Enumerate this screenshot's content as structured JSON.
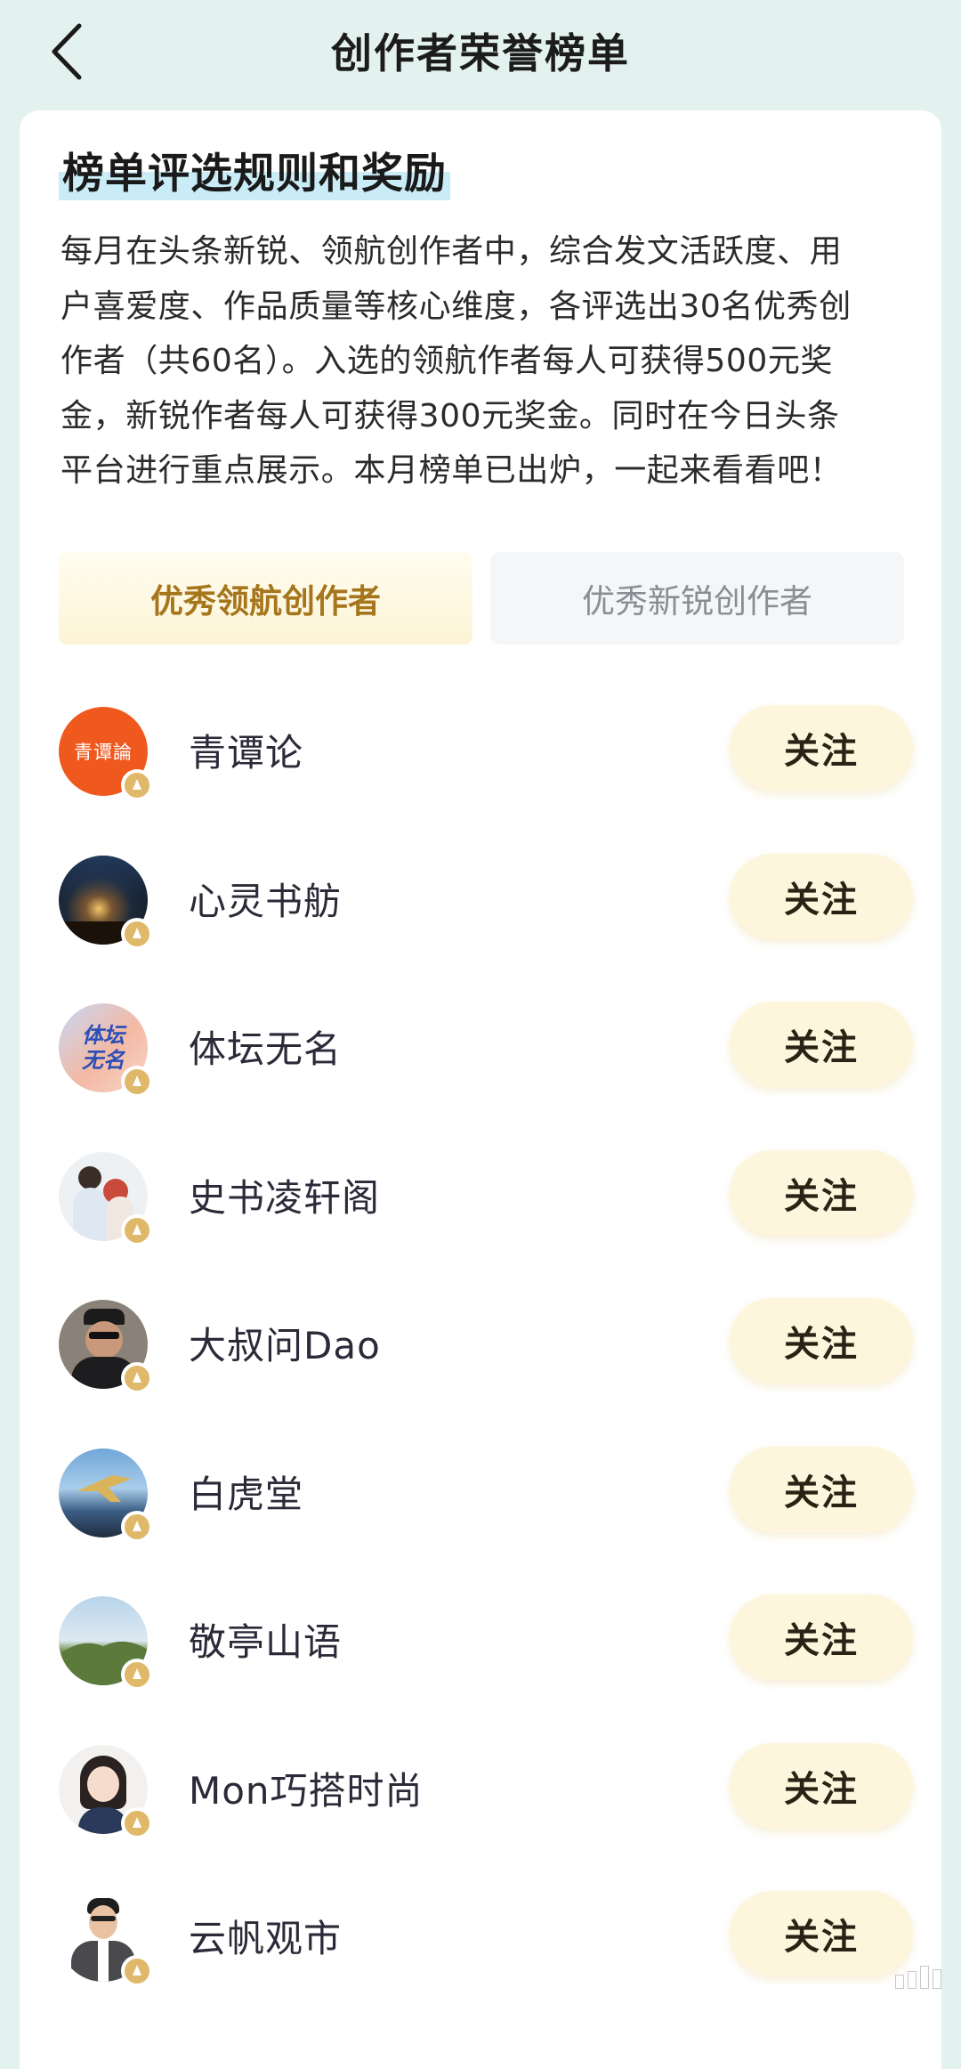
{
  "header": {
    "title": "创作者荣誉榜单",
    "back_icon": "back-arrow-icon"
  },
  "rules": {
    "heading": "榜单评选规则和奖励",
    "lines": [
      "每月在头条新锐、领航创作者中，综合发文活跃度、用",
      "户喜爱度、作品质量等核心维度，各评选出30名优秀创",
      "作者（共60名）。入选的领航作者每人可获得500元奖",
      "金，新锐作者每人可获得300元奖金。同时在今日头条",
      "平台进行重点展示。本月榜单已出炉，一起来看看吧！"
    ]
  },
  "tabs": [
    {
      "label": "优秀领航创作者",
      "active": true
    },
    {
      "label": "优秀新锐创作者",
      "active": false
    }
  ],
  "creators": [
    {
      "name": "青谭论",
      "follow": "关注",
      "avatar_text": "青谭論"
    },
    {
      "name": "心灵书舫",
      "follow": "关注"
    },
    {
      "name": "体坛无名",
      "follow": "关注",
      "avatar_text": "体坛无名"
    },
    {
      "name": "史书凌轩阁",
      "follow": "关注"
    },
    {
      "name": "大叔问Dao",
      "follow": "关注"
    },
    {
      "name": "白虎堂",
      "follow": "关注"
    },
    {
      "name": "敬亭山语",
      "follow": "关注"
    },
    {
      "name": "Mon巧搭时尚",
      "follow": "关注"
    },
    {
      "name": "云帆观市",
      "follow": "关注"
    }
  ],
  "colors": {
    "page_bg": "#e4f2ef",
    "active_tab_text": "#a6761d",
    "follow_bg": "#fdf6dd",
    "badge": "#e0b86a"
  }
}
